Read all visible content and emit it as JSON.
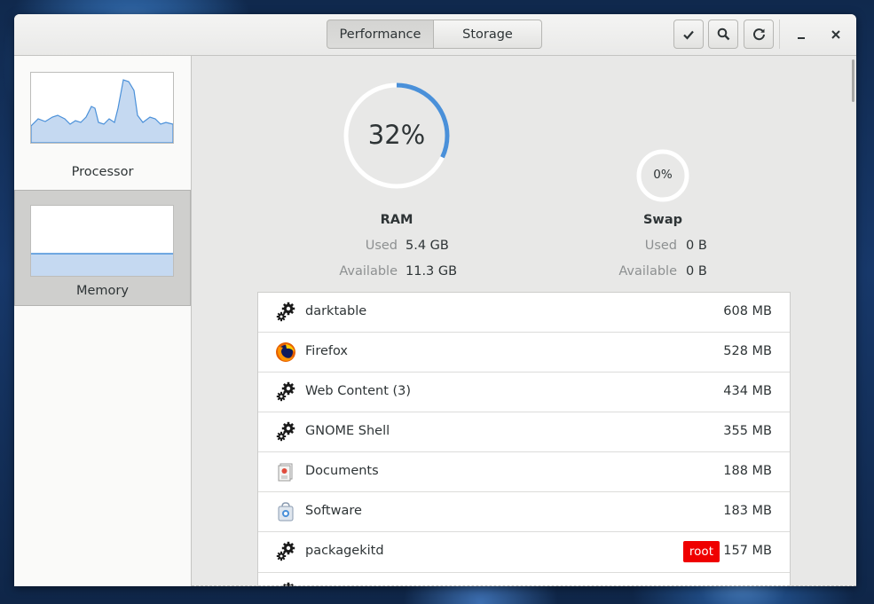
{
  "header": {
    "tabs": [
      {
        "label": "Performance",
        "active": true
      },
      {
        "label": "Storage",
        "active": false
      }
    ],
    "buttons": [
      "check-icon",
      "search-icon",
      "refresh-icon"
    ],
    "window_controls": [
      "minimize-icon",
      "close-icon"
    ]
  },
  "sidebar": {
    "items": [
      {
        "label": "Processor",
        "selected": false
      },
      {
        "label": "Memory",
        "selected": true
      }
    ]
  },
  "ram": {
    "percent_text": "32%",
    "percent": 0.32,
    "label": "RAM",
    "used_key": "Used",
    "used_val": "5.4 GB",
    "avail_key": "Available",
    "avail_val": "11.3 GB"
  },
  "swap": {
    "percent_text": "0%",
    "percent": 0,
    "label": "Swap",
    "used_key": "Used",
    "used_val": "0 B",
    "avail_key": "Available",
    "avail_val": "0 B"
  },
  "processes": [
    {
      "name": "darktable",
      "size": "608 MB",
      "icon": "gears-icon",
      "badge": ""
    },
    {
      "name": "Firefox",
      "size": "528 MB",
      "icon": "firefox-icon",
      "badge": ""
    },
    {
      "name": "Web Content (3)",
      "size": "434 MB",
      "icon": "gears-icon",
      "badge": ""
    },
    {
      "name": "GNOME Shell",
      "size": "355 MB",
      "icon": "gears-icon",
      "badge": ""
    },
    {
      "name": "Documents",
      "size": "188 MB",
      "icon": "documents-icon",
      "badge": ""
    },
    {
      "name": "Software",
      "size": "183 MB",
      "icon": "software-icon",
      "badge": ""
    },
    {
      "name": "packagekitd",
      "size": "157 MB",
      "icon": "gears-icon",
      "badge": "root"
    }
  ],
  "colors": {
    "accent": "#4a90d9",
    "badge": "#ef0000"
  }
}
